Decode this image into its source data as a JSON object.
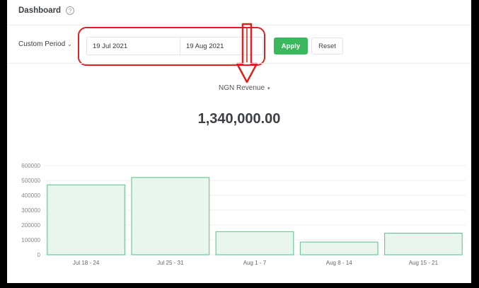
{
  "header": {
    "title": "Dashboard",
    "help_icon": "?"
  },
  "filters": {
    "period_label": "Custom Period",
    "period_chevron": "⌄",
    "start_date": "19 Jul 2021",
    "end_date": "19 Aug 2021",
    "apply_label": "Apply",
    "reset_label": "Reset"
  },
  "metric": {
    "selected": "NGN Revenue",
    "caret": "▾",
    "total": "1,340,000.00"
  },
  "annotation": {
    "highlight_color": "#e0201c",
    "arrow_icon": "down-arrow-icon"
  },
  "colors": {
    "accent": "#3bb75e",
    "bar_fill": "#e8f6ee",
    "bar_stroke": "#71c99a"
  },
  "chart_data": {
    "type": "bar",
    "categories": [
      "Jul 18 - 24",
      "Jul 25 - 31",
      "Aug 1 - 7",
      "Aug 8 - 14",
      "Aug 15 - 21"
    ],
    "values": [
      470000,
      520000,
      155000,
      85000,
      145000
    ],
    "ylim": [
      0,
      600000
    ],
    "yticks": [
      0,
      100000,
      200000,
      300000,
      400000,
      500000,
      600000
    ],
    "ytick_labels": [
      "0",
      "100000",
      "200000",
      "300000",
      "400000",
      "500000",
      "600000"
    ],
    "grid": true,
    "title": "",
    "xlabel": "",
    "ylabel": ""
  }
}
